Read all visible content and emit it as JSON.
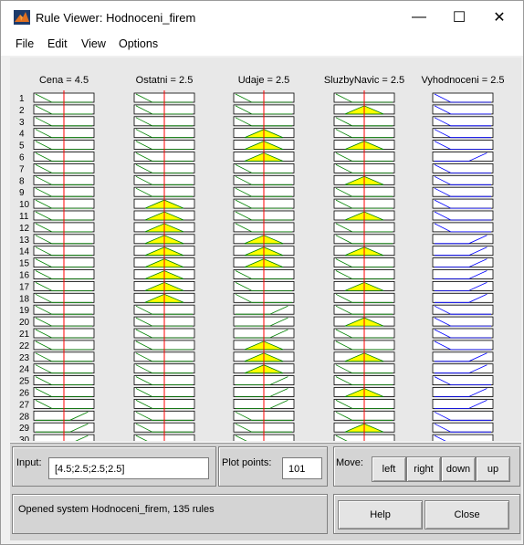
{
  "window": {
    "title": "Rule Viewer: Hodnoceni_firem",
    "controls": {
      "minimize": "—",
      "maximize": "☐",
      "close": "✕"
    }
  },
  "menu": [
    "File",
    "Edit",
    "View",
    "Options"
  ],
  "columns": [
    {
      "label": "Cena = 4.5",
      "kind": "input"
    },
    {
      "label": "Ostatni = 2.5",
      "kind": "input"
    },
    {
      "label": "Udaje = 2.5",
      "kind": "input"
    },
    {
      "label": "SluzbyNavic = 2.5",
      "kind": "input"
    },
    {
      "label": "Vyhodnoceni = 2.5",
      "kind": "output"
    }
  ],
  "rules": [
    [
      "d",
      "d",
      "d",
      "d",
      "d"
    ],
    [
      "d",
      "d",
      "d",
      "a",
      "d"
    ],
    [
      "d",
      "d",
      "d",
      "d",
      "d"
    ],
    [
      "d",
      "d",
      "a",
      "d",
      "d"
    ],
    [
      "d",
      "d",
      "a",
      "a",
      "d"
    ],
    [
      "d",
      "d",
      "a",
      "d",
      "u"
    ],
    [
      "d",
      "d",
      "d",
      "d",
      "d"
    ],
    [
      "d",
      "d",
      "d",
      "a",
      "d"
    ],
    [
      "d",
      "d",
      "d",
      "d",
      "d"
    ],
    [
      "d",
      "a",
      "d",
      "d",
      "d"
    ],
    [
      "d",
      "a",
      "d",
      "a",
      "d"
    ],
    [
      "d",
      "a",
      "d",
      "d",
      "d"
    ],
    [
      "d",
      "a",
      "a",
      "d",
      "u"
    ],
    [
      "d",
      "a",
      "a",
      "a",
      "u"
    ],
    [
      "d",
      "a",
      "a",
      "d",
      "u"
    ],
    [
      "d",
      "a",
      "d",
      "d",
      "u"
    ],
    [
      "d",
      "a",
      "d",
      "a",
      "u"
    ],
    [
      "d",
      "a",
      "d",
      "d",
      "u"
    ],
    [
      "d",
      "d",
      "u",
      "d",
      "d"
    ],
    [
      "d",
      "d",
      "u",
      "a",
      "d"
    ],
    [
      "d",
      "d",
      "u",
      "d",
      "d"
    ],
    [
      "d",
      "d",
      "a",
      "d",
      "d"
    ],
    [
      "d",
      "d",
      "a",
      "a",
      "u"
    ],
    [
      "d",
      "d",
      "a",
      "d",
      "u"
    ],
    [
      "d",
      "d",
      "u",
      "d",
      "d"
    ],
    [
      "d",
      "d",
      "u",
      "a",
      "u"
    ],
    [
      "d",
      "d",
      "u",
      "d",
      "u"
    ],
    [
      "u",
      "d",
      "d",
      "d",
      "d"
    ],
    [
      "u",
      "d",
      "d",
      "a",
      "d"
    ],
    [
      "u",
      "d",
      "d",
      "d",
      "d"
    ]
  ],
  "inputs": {
    "input_label": "Input:",
    "input_value": "[4.5;2.5;2.5;2.5]",
    "plot_points_label": "Plot points:",
    "plot_points_value": "101",
    "move_label": "Move:"
  },
  "buttons": {
    "left": "left",
    "right": "right",
    "down": "down",
    "up": "up",
    "help": "Help",
    "close": "Close"
  },
  "status": "Opened system Hodnoceni_firem, 135 rules",
  "colors": {
    "yellow": "#ffff00",
    "red_line": "#ff0000",
    "green_line": "#008000",
    "blue_line": "#0000ff"
  }
}
